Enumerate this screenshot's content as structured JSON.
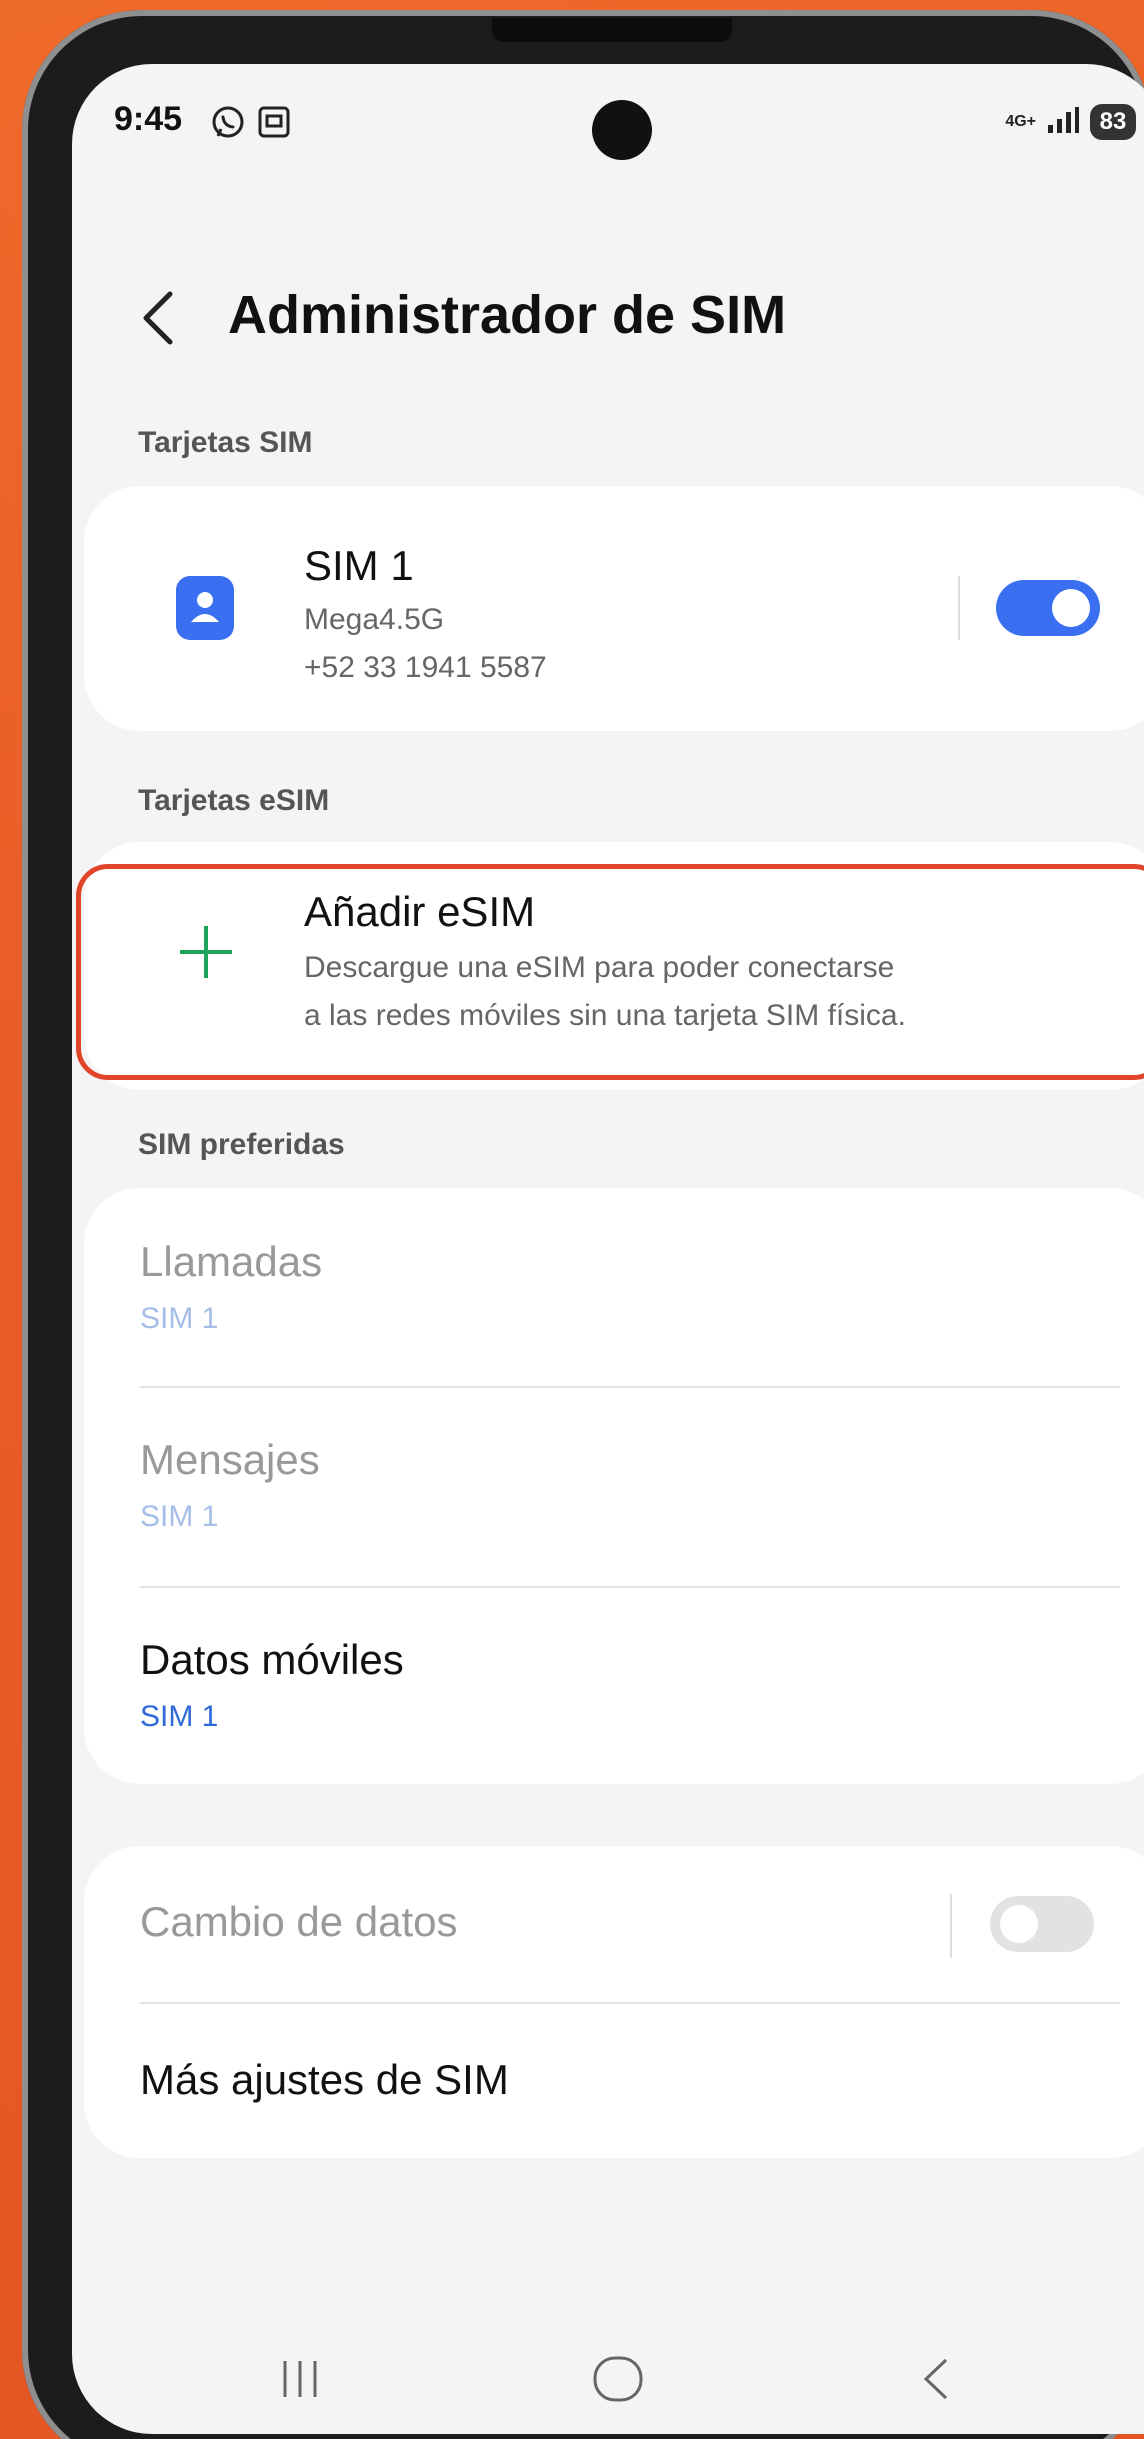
{
  "status_bar": {
    "time": "9:45",
    "network_type": "4G+",
    "battery_level": "83",
    "icons": [
      "whatsapp-icon",
      "screenshot-icon",
      "signal-icon"
    ]
  },
  "header": {
    "title": "Administrador de SIM",
    "back_icon": "chevron-left-icon"
  },
  "sim_section": {
    "label": "Tarjetas SIM",
    "sim": {
      "name": "SIM 1",
      "carrier": "Mega4.5G",
      "number": "+52 33 1941 5587",
      "enabled": true
    }
  },
  "esim_section": {
    "label": "Tarjetas eSIM",
    "add": {
      "title": "Añadir eSIM",
      "desc_line1": "Descargue una eSIM para poder conectarse",
      "desc_line2": "a las redes móviles sin una tarjeta SIM física."
    }
  },
  "preferred_section": {
    "label": "SIM preferidas",
    "items": [
      {
        "title": "Llamadas",
        "value": "SIM 1",
        "enabled": false
      },
      {
        "title": "Mensajes",
        "value": "SIM 1",
        "enabled": false
      },
      {
        "title": "Datos móviles",
        "value": "SIM 1",
        "enabled": true
      }
    ]
  },
  "other_section": {
    "data_switch": {
      "title": "Cambio de datos",
      "enabled": false,
      "toggle_on": false
    },
    "more": {
      "title": "Más ajustes de SIM"
    }
  },
  "nav_bar": {
    "icons": [
      "recent-apps-icon",
      "home-icon",
      "back-icon"
    ]
  },
  "colors": {
    "accent": "#3b6ff2",
    "link": "#2f6ad8",
    "plus": "#1ea35c",
    "highlight": "#e0452a",
    "background": "#e85a26"
  }
}
